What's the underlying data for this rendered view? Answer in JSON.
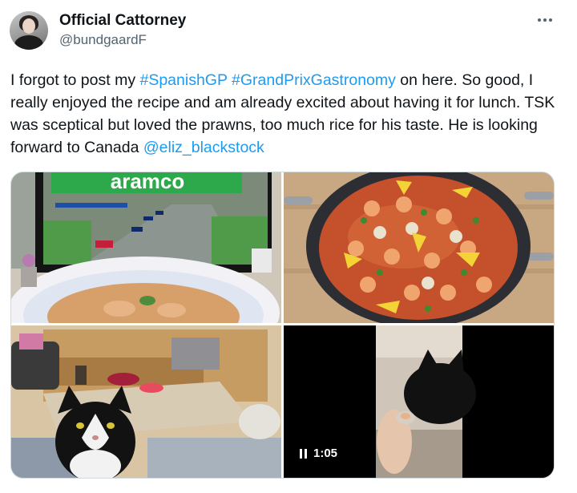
{
  "author": {
    "display_name": "Official Cattorney",
    "handle": "@bundgaardF"
  },
  "post": {
    "segments": [
      {
        "text": "I forgot to post my ",
        "link": false
      },
      {
        "text": "#SpanishGP",
        "link": true
      },
      {
        "text": " ",
        "link": false
      },
      {
        "text": "#GrandPrixGastronomy",
        "link": true
      },
      {
        "text": " on here. So good, I really enjoyed the recipe and am already excited about having it for lunch. TSK was sceptical but loved the prawns, too much rice for his taste. He is looking forward to Canada ",
        "link": false
      },
      {
        "text": "@eliz_blackstock",
        "link": true
      }
    ]
  },
  "media": {
    "tv_banner_text": "aramco",
    "video_duration": "1:05"
  },
  "colors": {
    "link": "#1d9bf0",
    "secondary_text": "#536471",
    "border": "#cfd9de"
  },
  "icons": {
    "more": "more-horizontal-icon",
    "pause": "pause-icon"
  }
}
